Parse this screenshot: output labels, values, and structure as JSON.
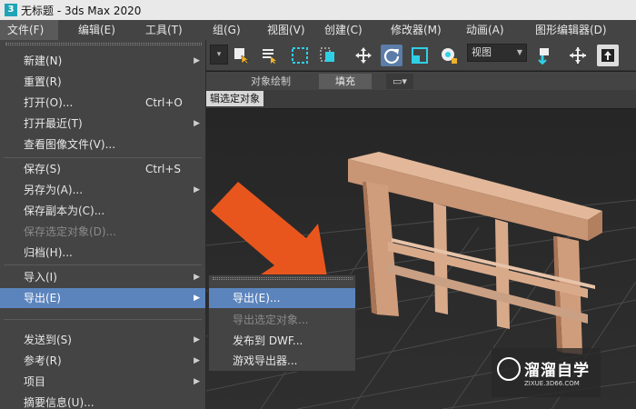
{
  "titlebar": {
    "app_icon": "3ds-max-icon",
    "title": "无标题 - 3ds Max 2020"
  },
  "menubar": [
    {
      "label": "文件(F)"
    },
    {
      "label": "编辑(E)"
    },
    {
      "label": "工具(T)"
    },
    {
      "label": "组(G)"
    },
    {
      "label": "视图(V)"
    },
    {
      "label": "创建(C)"
    },
    {
      "label": "修改器(M)"
    },
    {
      "label": "动画(A)"
    },
    {
      "label": "图形编辑器(D)"
    }
  ],
  "toolbar": {
    "view_combo": "视图",
    "icons": [
      "select-object-icon",
      "select-by-name-icon",
      "rect-selection-icon",
      "window-crossing-icon",
      "move-icon",
      "rotate-icon",
      "scale-icon",
      "place-icon",
      "link-icon",
      "snap-icon",
      "pivot-icon"
    ]
  },
  "ribbon": {
    "tabs": [
      {
        "label": "对象绘制"
      },
      {
        "label": "填充"
      }
    ],
    "edit_selected": "辑选定对象"
  },
  "file_menu": {
    "items": [
      {
        "label": "新建(N)",
        "submenu": true
      },
      {
        "label": "重置(R)"
      },
      {
        "label": "打开(O)...",
        "shortcut": "Ctrl+O"
      },
      {
        "label": "打开最近(T)",
        "submenu": true
      },
      {
        "label": "查看图像文件(V)..."
      },
      {
        "label": "保存(S)",
        "shortcut": "Ctrl+S"
      },
      {
        "label": "另存为(A)...",
        "submenu": true
      },
      {
        "label": "保存副本为(C)..."
      },
      {
        "label": "保存选定对象(D)...",
        "disabled": true
      },
      {
        "label": "归档(H)..."
      },
      {
        "label": "导入(I)",
        "submenu": true
      },
      {
        "label": "导出(E)",
        "submenu": true,
        "highlighted": true
      },
      {
        "label": "发送到(S)",
        "submenu": true
      },
      {
        "label": "参考(R)",
        "submenu": true
      },
      {
        "label": "项目",
        "submenu": true
      },
      {
        "label": "摘要信息(U)..."
      }
    ]
  },
  "export_submenu": {
    "items": [
      {
        "label": "导出(E)...",
        "highlighted": true
      },
      {
        "label": "导出选定对象...",
        "disabled": true
      },
      {
        "label": "发布到 DWF..."
      },
      {
        "label": "游戏导出器..."
      }
    ]
  },
  "watermark": {
    "brand": "溜溜自学",
    "url": "ZIXUE.3D66.COM"
  },
  "colors": {
    "highlight": "#5b84bd",
    "menu_bg": "#444444",
    "arrow": "#e8561e",
    "wood": "#d7a888"
  }
}
